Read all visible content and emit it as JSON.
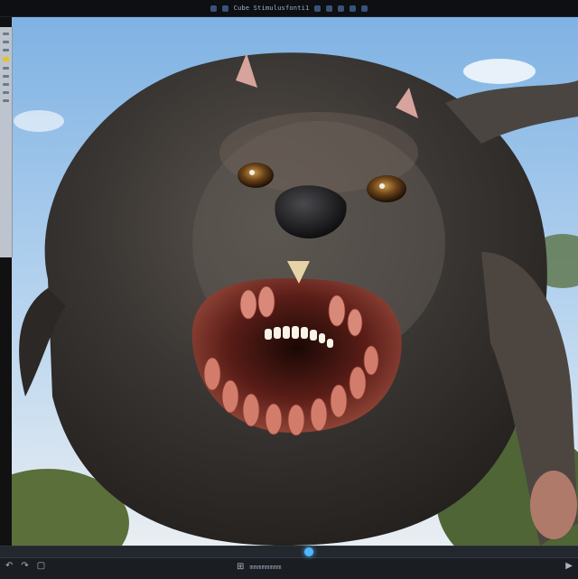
{
  "window": {
    "title": "Cube Stimulusfonti1",
    "toolbar_icons": [
      "arrow-icon",
      "cube-icon",
      "layers-icon",
      "gear-icon",
      "brush-icon",
      "settings-icon",
      "help-icon"
    ]
  },
  "sidebar": {
    "tools": [
      "select-tool",
      "move-tool",
      "rotate-tool",
      "color-tool",
      "scale-tool",
      "brush-tool",
      "eraser-tool",
      "camera-tool",
      "light-tool"
    ]
  },
  "viewport": {
    "image_alt": "Rendered furry monster creature",
    "colors": {
      "sky": "#9ec4e8",
      "fur": "#3a3633",
      "mouth": "#5a1d17"
    }
  },
  "bottom_bar": {
    "status_text": "mmmmmmmm",
    "icons": [
      "undo-icon",
      "redo-icon",
      "crop-icon",
      "frame-icon",
      "play-icon"
    ]
  }
}
